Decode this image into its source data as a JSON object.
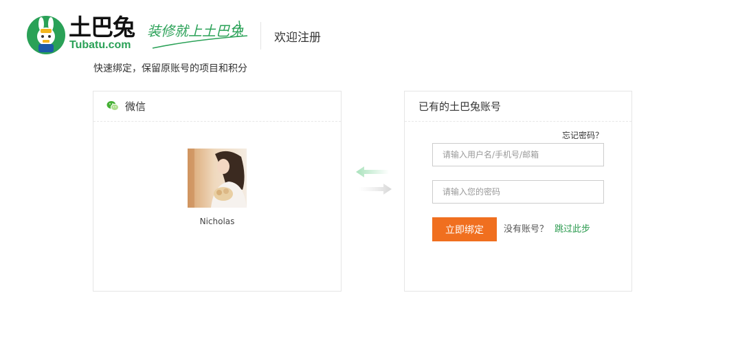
{
  "header": {
    "logo_cn": "土巴兔",
    "logo_en": "Tubatu.com",
    "slogan": "装修就上土巴兔",
    "welcome": "欢迎注册",
    "brand_color": "#2aa157"
  },
  "subtitle": "快速绑定，保留原账号的项目和积分",
  "left_panel": {
    "title": "微信",
    "icon": "wechat-icon",
    "nickname": "Nicholas"
  },
  "right_panel": {
    "title": "已有的土巴兔账号",
    "forgot_password": "忘记密码？",
    "username_placeholder": "请输入用户名/手机号/邮箱",
    "password_placeholder": "请输入您的密码",
    "bind_button": "立即绑定",
    "no_account": "没有账号？",
    "skip_link": "跳过此步",
    "button_color": "#f06f1f",
    "link_color": "#2a9a4e"
  }
}
